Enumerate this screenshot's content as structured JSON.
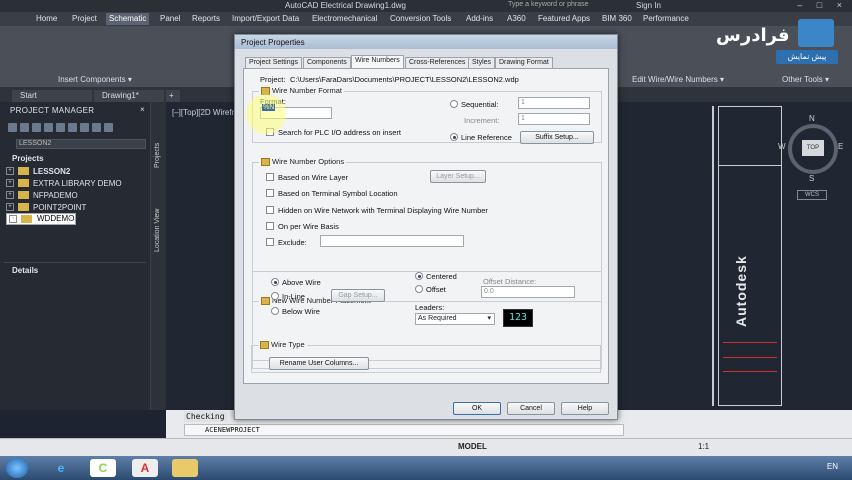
{
  "titlebar": {
    "title": "AutoCAD Electrical    Drawing1.dwg",
    "search_placeholder": "Type a keyword or phrase",
    "signin": "Sign In",
    "window_controls": "– □ ×"
  },
  "ribbon_tabs": [
    "Home",
    "Project",
    "Schematic",
    "Panel",
    "Reports",
    "Import/Export Data",
    "Electromechanical",
    "Conversion Tools",
    "Add-ins",
    "A360",
    "Featured Apps",
    "BIM 360",
    "Performance"
  ],
  "ribbon_active": "Schematic",
  "ribbon_panels": {
    "insert_components": "Insert Components ▾",
    "edit_wire_numbers": "Edit Wire/Wire Numbers ▾",
    "other_tools": "Other Tools ▾"
  },
  "doc_tabs": [
    "Start",
    "Drawing1*",
    "+"
  ],
  "project_manager": {
    "header": "PROJECT MANAGER",
    "close": "×",
    "combo_value": "LESSON2",
    "projects_header": "Projects",
    "projects": [
      "LESSON2",
      "EXTRA LIBRARY DEMO",
      "NFPADEMO",
      "POINT2POINT",
      "WDDEMO"
    ],
    "details_header": "Details"
  },
  "side_labels": {
    "projects": "Projects",
    "location_view": "Location View"
  },
  "drawing": {
    "viewport_label": "[–][Top][2D Wireframe]",
    "logo": "Autodesk",
    "navcube": {
      "top": "TOP",
      "n": "N",
      "s": "S",
      "e": "E",
      "w": "W",
      "wcs": "WCS"
    }
  },
  "command": {
    "checking": "Checking",
    "prompt": "ACENEWPROJECT"
  },
  "status": {
    "model": "MODEL",
    "scale": "1:1"
  },
  "taskbar": {
    "lang": "EN",
    "icons": [
      "ie-icon",
      "cadmonkey-icon",
      "autocad-icon",
      "explorer-icon"
    ]
  },
  "watermark": {
    "brand": "فرادرس",
    "pill": "پیش نمایش"
  },
  "dialog": {
    "title": "Project Properties",
    "tabs": [
      "Project Settings",
      "Components",
      "Wire Numbers",
      "Cross-References",
      "Styles",
      "Drawing Format"
    ],
    "active_tab": "Wire Numbers",
    "project_label": "Project:",
    "project_path": "C:\\Users\\FaraDars\\Documents\\PROJECT\\LESSON2\\LESSON2.wdp",
    "wire_number_format": {
      "title": "Wire Number Format",
      "format_label": "Format:",
      "format_value": "%N",
      "search_plc": "Search for PLC I/O address on insert",
      "sequential": "Sequential:",
      "sequential_value": "1",
      "increment": "Increment:",
      "increment_value": "1",
      "line_reference": "Line Reference",
      "suffix_setup": "Suffix Setup..."
    },
    "wire_number_options": {
      "title": "Wire Number Options",
      "based_on_wire_layer": "Based on Wire Layer",
      "layer_setup": "Layer Setup...",
      "based_on_terminal": "Based on Terminal Symbol Location",
      "hidden_on_wire_network": "Hidden on Wire Network with Terminal Displaying Wire Number",
      "on_per_wire_basis": "On per Wire Basis",
      "exclude": "Exclude:"
    },
    "new_wire_number_placement": {
      "title": "New Wire Number Placement",
      "above_wire": "Above Wire",
      "in_line": "In-Line",
      "gap_setup": "Gap Setup...",
      "below_wire": "Below Wire",
      "centered": "Centered",
      "offset": "Offset",
      "offset_distance": "Offset Distance:",
      "offset_value": "0.0",
      "leaders": "Leaders:",
      "leaders_value": "As Required",
      "preview": "123"
    },
    "wire_type": {
      "title": "Wire Type",
      "rename_user_columns": "Rename User Columns..."
    },
    "buttons": {
      "ok": "OK",
      "cancel": "Cancel",
      "help": "Help"
    }
  }
}
